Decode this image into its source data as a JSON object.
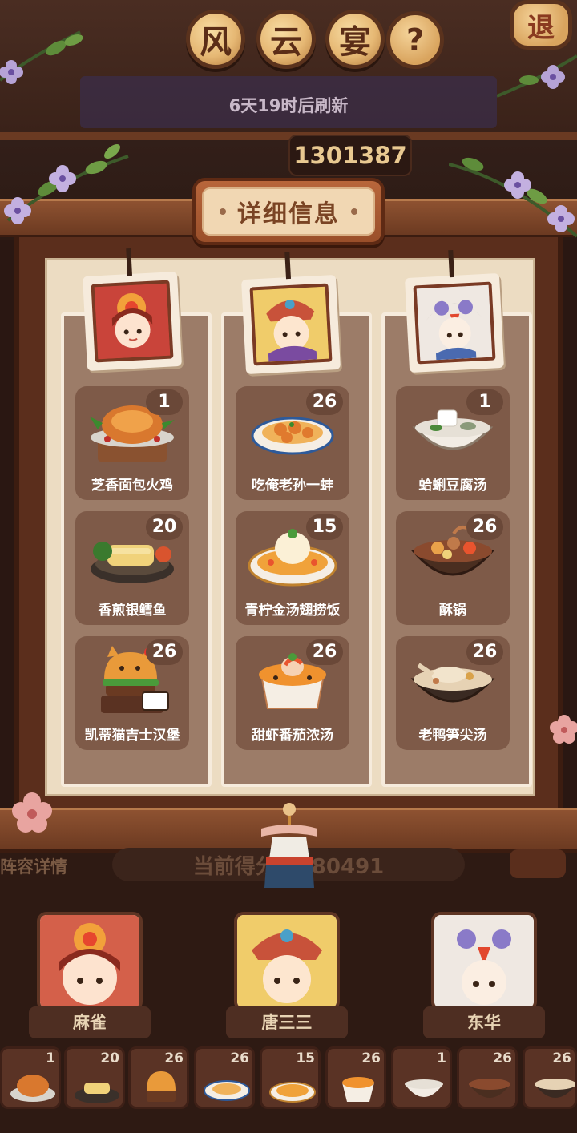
{
  "header": {
    "title_chars": [
      "风",
      "云",
      "宴"
    ],
    "help_label": "?",
    "exit_label": "退",
    "refresh_text": "6天19时后刷新",
    "top_score": "1301387"
  },
  "panel": {
    "title": "详细信息",
    "columns": [
      {
        "chef": "mahjong-sparrow-chef",
        "dishes": [
          {
            "name": "芝香面包火鸡",
            "count": "1",
            "icon": "roast-turkey-icon"
          },
          {
            "name": "香煎银鳕鱼",
            "count": "20",
            "icon": "pan-fried-cod-icon"
          },
          {
            "name": "凯蒂猫吉士汉堡",
            "count": "26",
            "icon": "hello-kitty-burger-icon"
          }
        ]
      },
      {
        "chef": "tang-sansan-chef",
        "dishes": [
          {
            "name": "吃俺老孙一蚌",
            "count": "26",
            "icon": "clam-dish-icon"
          },
          {
            "name": "青柠金汤翅捞饭",
            "count": "15",
            "icon": "golden-soup-rice-icon"
          },
          {
            "name": "甜虾番茄浓汤",
            "count": "26",
            "icon": "shrimp-tomato-soup-icon"
          }
        ]
      },
      {
        "chef": "donghua-chef",
        "dishes": [
          {
            "name": "蛤蜊豆腐汤",
            "count": "1",
            "icon": "clam-tofu-soup-icon"
          },
          {
            "name": "酥锅",
            "count": "26",
            "icon": "crispy-pot-icon"
          },
          {
            "name": "老鸭笋尖汤",
            "count": "26",
            "icon": "duck-bamboo-soup-icon"
          }
        ]
      }
    ]
  },
  "bottom": {
    "left_label": "阵容详情",
    "score_text": "当前得分：780491",
    "chefs": [
      {
        "name": "麻雀"
      },
      {
        "name": "唐三三"
      },
      {
        "name": "东华"
      }
    ],
    "strip": [
      "1",
      "20",
      "26",
      "26",
      "15",
      "26",
      "1",
      "26",
      "26"
    ]
  },
  "colors": {
    "card_bg": "#7e5a48",
    "column_bg": "#9c7c68",
    "panel_bg": "#ecdcc2",
    "frame_wood": "#6c3a21",
    "title_plate": "#e6b874"
  }
}
